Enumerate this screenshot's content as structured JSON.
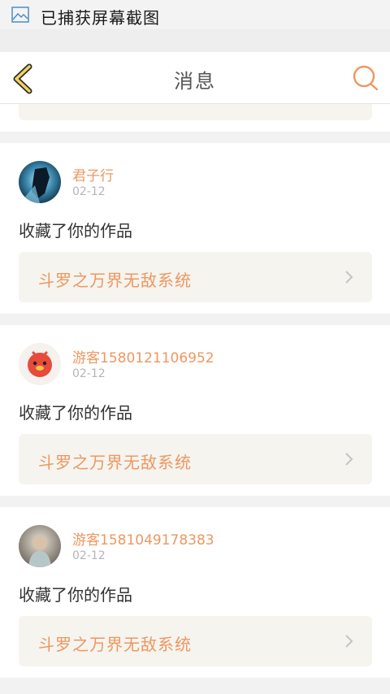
{
  "status_bar": {
    "text": "已捕获屏幕截图",
    "icon": "image-icon"
  },
  "header": {
    "title": "消息",
    "back_icon": "chevron-left-icon",
    "search_icon": "search-icon"
  },
  "colors": {
    "accent": "#ee9760",
    "back_yellow": "#f2d35c",
    "card_link_bg": "#f5f4ef"
  },
  "messages": [
    {
      "username": "君子行",
      "date": "02-12",
      "action": "收藏了你的作品",
      "work_title": "斗罗之万界无敌系统",
      "avatar": "anime-avatar"
    },
    {
      "username": "游客1580121106952",
      "date": "02-12",
      "action": "收藏了你的作品",
      "work_title": "斗罗之万界无敌系统",
      "avatar": "red-bird-avatar"
    },
    {
      "username": "游客1581049178383",
      "date": "02-12",
      "action": "收藏了你的作品",
      "work_title": "斗罗之万界无敌系统",
      "avatar": "photo-avatar"
    }
  ]
}
